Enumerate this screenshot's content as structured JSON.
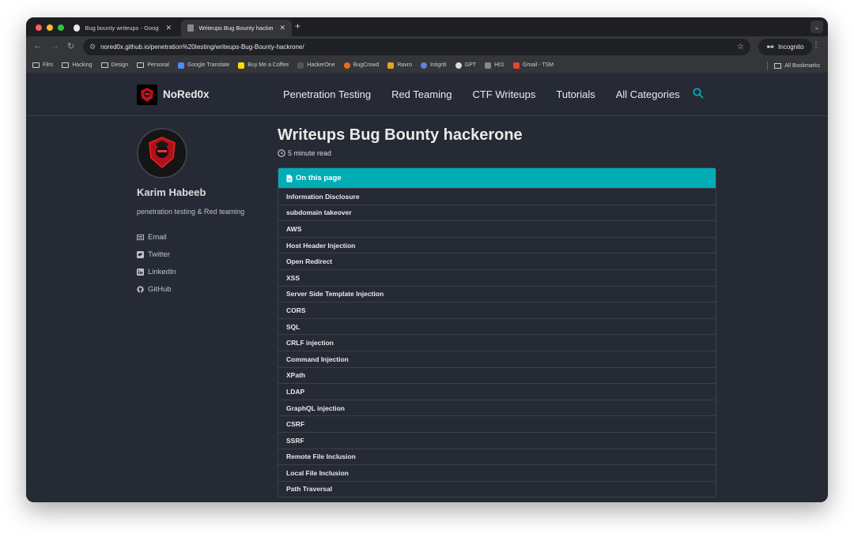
{
  "browser": {
    "tabs": [
      {
        "title": "Bug bounty writeups - Google",
        "active": false
      },
      {
        "title": "Writeups Bug Bounty hackerone",
        "active": true
      }
    ],
    "url": "nored0x.github.io/penetration%20testing/writeups-Bug-Bounty-hackrone/",
    "profile_label": "Incognito",
    "bookmarks": [
      "Film",
      "Hacking",
      "Design",
      "Personal",
      "Google Translate",
      "Buy Me a Coffee",
      "HackerOne",
      "BugCrowd",
      "Ravro",
      "Intigriti",
      "GPT",
      "H01",
      "Gmail - TSM"
    ],
    "all_bookmarks_label": "All Bookmarks"
  },
  "site": {
    "title": "NoRed0x",
    "nav": [
      "Penetration Testing",
      "Red Teaming",
      "CTF Writeups",
      "Tutorials",
      "All Categories"
    ]
  },
  "author": {
    "name": "Karim Habeeb",
    "bio": "penetration testing & Red teaming",
    "links": [
      {
        "label": "Email",
        "icon": "envelope-icon"
      },
      {
        "label": "Twitter",
        "icon": "twitter-icon"
      },
      {
        "label": "LinkedIn",
        "icon": "linkedin-icon"
      },
      {
        "label": "GitHub",
        "icon": "github-icon"
      }
    ]
  },
  "post": {
    "title": "Writeups Bug Bounty hackerone",
    "read_time": "5 minute read",
    "toc_title": "On this page",
    "toc": [
      "Information Disclosure",
      "subdomain takeover",
      "AWS",
      "Host Header Injection",
      "Open Redirect",
      "XSS",
      "Server Side Template Injection",
      "CORS",
      "SQL",
      "CRLF injection",
      "Command Injection",
      "XPath",
      "LDAP",
      "GraphQL injection",
      "CSRF",
      "SSRF",
      "Remote File Inclusion",
      "Local File Inclusion",
      "Path Traversal"
    ]
  },
  "colors": {
    "accent": "#00adb5",
    "background": "#252a34"
  }
}
